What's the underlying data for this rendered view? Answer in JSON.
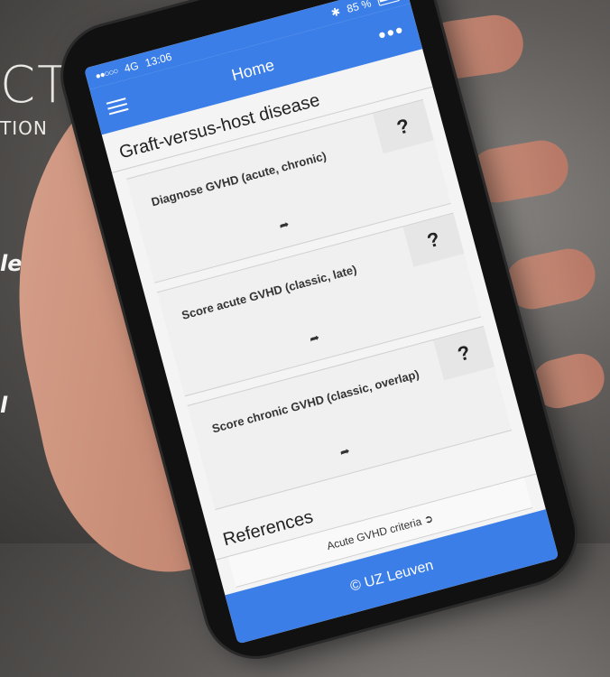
{
  "backdrop": {
    "brand_big": "CT",
    "brand_small": "TION",
    "fragment_1": "les",
    "fragment_2": "l"
  },
  "status_bar": {
    "carrier": "●●○○○",
    "network": "4G",
    "time": "13:06",
    "bluetooth": "✱",
    "battery": "85 %"
  },
  "nav": {
    "title": "Home",
    "more_icon": "•••",
    "menu_icon": "hamburger-icon"
  },
  "section": {
    "title": "Graft-versus-host disease"
  },
  "cards": [
    {
      "label": "Diagnose GVHD (acute, chronic)",
      "arrow": "➦",
      "help": "?"
    },
    {
      "label": "Score acute GVHD (classic, late)",
      "arrow": "➦",
      "help": "?"
    },
    {
      "label": "Score chronic GVHD (classic, overlap)",
      "arrow": "➦",
      "help": "?"
    }
  ],
  "references": {
    "title": "References",
    "items": [
      {
        "label": "Acute GVHD criteria ➲"
      }
    ]
  },
  "footer": {
    "label": "© UZ Leuven"
  },
  "colors": {
    "accent": "#3b7ee8",
    "background": "#f4f4f4"
  }
}
